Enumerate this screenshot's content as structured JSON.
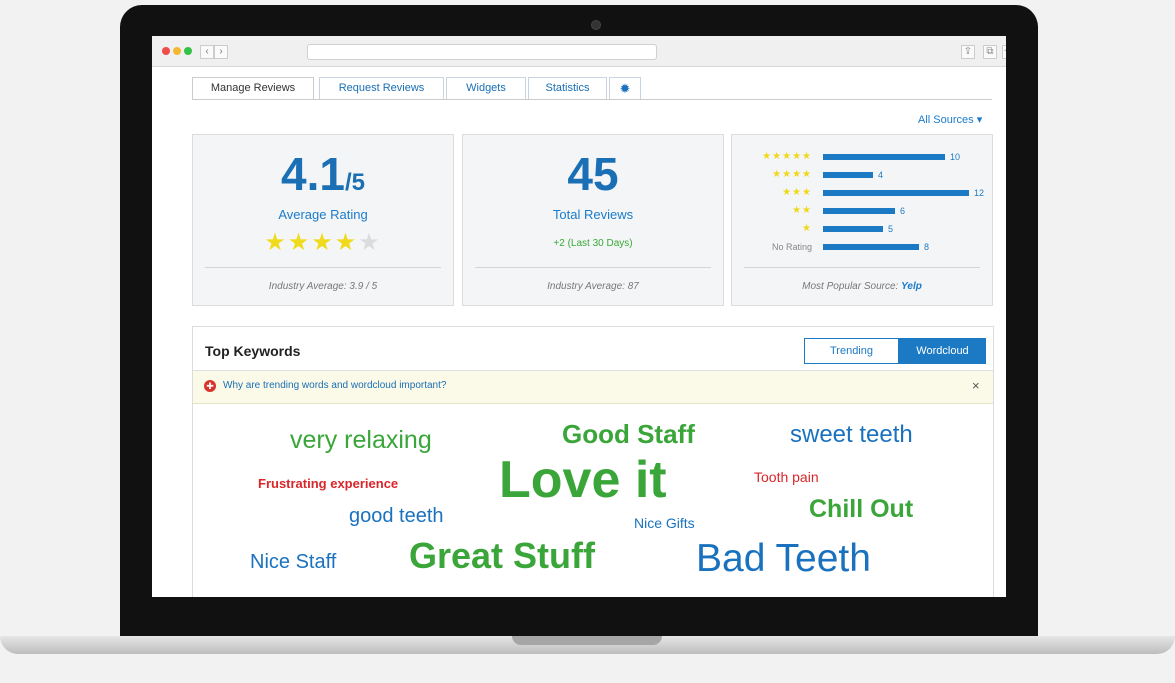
{
  "browser": {
    "nav_back": "‹",
    "nav_forward": "›",
    "share_glyph": "⇪",
    "tabs_glyph": "⧉",
    "newtab_glyph": "+"
  },
  "tabs": [
    {
      "label": "Manage Reviews"
    },
    {
      "label": "Request Reviews"
    },
    {
      "label": "Widgets"
    },
    {
      "label": "Statistics"
    }
  ],
  "settings_icon_glyph": "✹",
  "sources_filter": "All Sources ▾",
  "rating_card": {
    "value": "4.1",
    "suffix": "/5",
    "label": "Average Rating",
    "stars_filled": 4,
    "stars_total": 5,
    "footer": "Industry Average: 3.9 / 5"
  },
  "total_card": {
    "value": "45",
    "label": "Total Reviews",
    "delta": "+2 (Last 30 Days)",
    "footer": "Industry Average: 87"
  },
  "distribution_card": {
    "rows": [
      {
        "label": "★★★★★",
        "count": "10"
      },
      {
        "label": "★★★★",
        "count": "4"
      },
      {
        "label": "★★★",
        "count": "12"
      },
      {
        "label": "★★",
        "count": "6"
      },
      {
        "label": "★",
        "count": "5"
      },
      {
        "label": "No Rating",
        "count": "8"
      }
    ],
    "footer_prefix": "Most Popular Source:",
    "footer_source": "Yelp"
  },
  "keywords": {
    "title": "Top Keywords",
    "toggle_trending": "Trending",
    "toggle_wordcloud": "Wordcloud",
    "info_text": "Why are trending words and wordcloud important?",
    "info_close": "×",
    "lifebuoy_glyph": "✚",
    "words": [
      {
        "text": "very relaxing"
      },
      {
        "text": "Good Staff"
      },
      {
        "text": "sweet teeth"
      },
      {
        "text": "Frustrating experience"
      },
      {
        "text": "Love it"
      },
      {
        "text": "Tooth pain"
      },
      {
        "text": "good teeth"
      },
      {
        "text": "Nice Gifts"
      },
      {
        "text": "Chill Out"
      },
      {
        "text": "Nice Staff"
      },
      {
        "text": "Great Stuff"
      },
      {
        "text": "Bad Teeth"
      }
    ]
  },
  "colors": {
    "accent_blue": "#1a72bf",
    "green": "#3aa63a",
    "red": "#d9262a",
    "star_yellow": "#f0da1c"
  }
}
